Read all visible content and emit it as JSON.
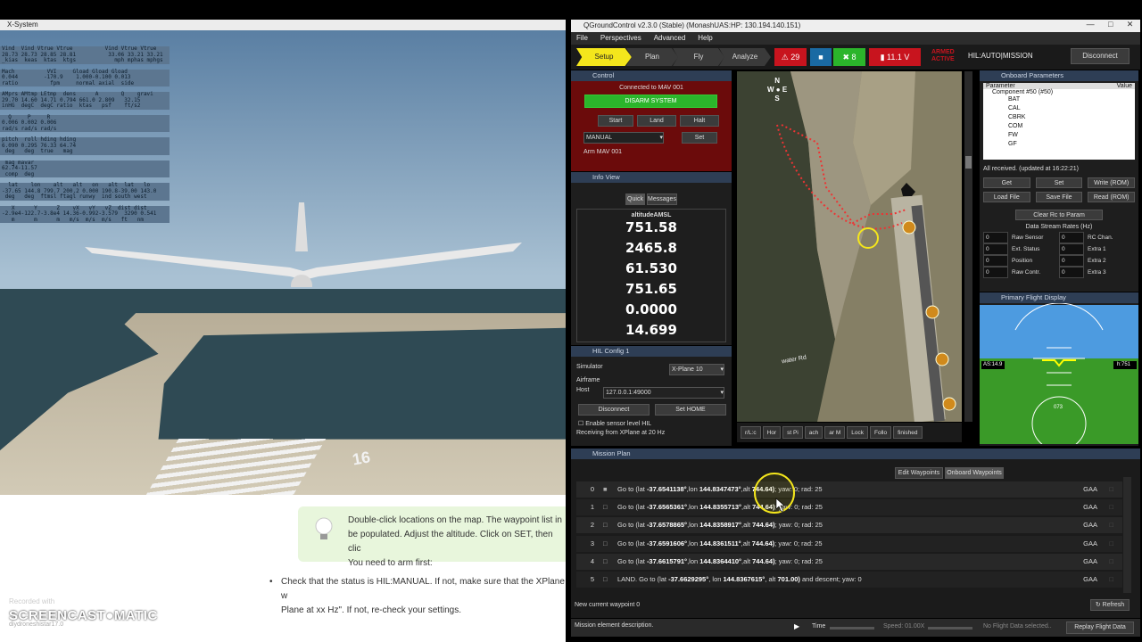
{
  "xplane": {
    "window_title": "X-System",
    "data_lines": [
      "Vind  Vind Vtrue Vtrue          Vind Vtrue Vtrue\n28.73 28.73 28.85 28.81          33.06 33.21 33.21\n_kias  keas  ktas  ktgs            mph mphas mphgs",
      "Mach          VVI     Gload Gload Gload\n0.044        -170.9    1.000-0.100 0.013\nratio          fpm     normal axial  side",
      "AMprs AMtmp LEtmp  dens      A       Q    gravi\n29.70 14.60 14.71 0.794 661.0 2.809   32.15\ninHG  degC  degC ratio  ktas   psf    ft/s2",
      "  Q     P     R\n0.006 0.002 0.006\nrad/s rad/s rad/s",
      "pitch  roll hding hding\n6.090 0.295 76.33 64.74\n deg   deg  true   mag",
      " mag mavar\n62.74-11.57\n comp  deg",
      "  lat    lon    alt   alt   on   alt  lat   lo\n-37.65 144.8 799.7 200.2 0.000 190.8-39.00 143.0\n deg   deg  ftmsl ftagl runwy  ind south west",
      "   X      Y      Z    vX   vY   vZ  dist dist\n-2.9e4-122.7-3.8e4 14.36-0.992-3.579  3290 0.541\n   m      m      m   m/s  m/s  m/s   ft   nm"
    ],
    "runway_number": "16"
  },
  "tutorial": {
    "tip_text": "Double-click locations on the map. The waypoint list in be populated. Adjust the altitude. Click on SET, then click You need to arm first:",
    "tip_line1": "Double-click locations on the map. The waypoint list in",
    "tip_line2": "be populated. Adjust the altitude. Click on SET, then clic",
    "tip_line3": "You need to arm first:",
    "bullet_line1": "Check that the status is HIL:MANUAL. If not, make sure that the XPlane w",
    "bullet_line2": "Plane at xx Hz\". If not, re-check your settings."
  },
  "watermark": {
    "recorded": "Recorded with",
    "brand": "SCREENCAST●MATIC",
    "url": "diydroneshistar17.0"
  },
  "qgc": {
    "title": "QGroundControl v2.3.0 (Stable) (MonashUAS:HP: 130.194.140.151)",
    "menu": [
      "File",
      "Perspectives",
      "Advanced",
      "Help"
    ],
    "tabs": [
      "Setup",
      "Plan",
      "Fly",
      "Analyze"
    ],
    "alerts_count": "29",
    "gps_count": "8",
    "battery": "11.1 V",
    "armed_state": "ARMED",
    "armed_sub": "ACTIVE",
    "mode": "HIL:AUTO|MISSION",
    "disconnect": "Disconnect",
    "control": {
      "title": "Control",
      "connected": "Connected to MAV 001",
      "disarm": "DISARM SYSTEM",
      "start": "Start",
      "land": "Land",
      "halt": "Halt",
      "mode_value": "MANUAL",
      "set": "Set",
      "status": "Arm MAV 001"
    },
    "info": {
      "title": "Info View",
      "tab_quick": "Quick",
      "tab_messages": "Messages",
      "label1": "altitudeAMSL",
      "values": [
        "751.58",
        "2465.8",
        "61.530",
        "751.65",
        "0.0000",
        "14.699"
      ]
    },
    "hil": {
      "title": "HIL Config 1",
      "simulator_label": "Simulator",
      "simulator_value": "X-Plane 10",
      "airframe_label": "Airframe",
      "host_label": "Host",
      "host_value": "127.0.0.1:49000",
      "disconnect": "Disconnect",
      "set_home": "Set HOME",
      "sensor_checkbox": "Enable sensor level HIL",
      "receiving": "Receiving from XPlane at 20 Hz"
    },
    "map_controls": [
      "r/L:c",
      "Hor",
      "st Pi",
      "ach",
      "ar M",
      "Lock",
      "Follo",
      "finished"
    ],
    "compass": {
      "n": "N",
      "s": "S",
      "e": "E",
      "w": "W"
    },
    "road_label": "water Rd",
    "params": {
      "title": "Onboard Parameters",
      "col_param": "Parameter",
      "col_value": "Value",
      "component": "Component #50 (#50)",
      "items": [
        "BAT",
        "CAL",
        "CBRK",
        "COM",
        "FW",
        "GF"
      ],
      "all_received": "All received. (updated at 16:22:21)",
      "buttons": [
        "Get",
        "Set",
        "Write (ROM)",
        "Load File",
        "Save File",
        "Read (ROM)"
      ],
      "clear_rc": "Clear Rc to Param",
      "rates_title": "Data Stream Rates (Hz)",
      "rates_left": [
        "Raw Sensor",
        "Ext. Status",
        "Position",
        "Raw Contr."
      ],
      "rates_right": [
        "RC Chan.",
        "Extra 1",
        "Extra 2",
        "Extra 3"
      ],
      "rate_value": "0"
    },
    "pfd": {
      "title": "Primary Flight Display",
      "left_tape": "AS:14.9",
      "right_tape": "h:751",
      "heading": "073"
    },
    "mission": {
      "title": "Mission Plan",
      "tab_edit": "Edit Waypoints",
      "tab_onboard": "Onboard Waypoints",
      "rows": [
        {
          "idx": "0",
          "pre": "Go to (lat ",
          "lat": "-37.6541138°",
          "mid": ",lon ",
          "lon": "144.8347473°",
          "alt_pre": ",alt ",
          "alt": "744.64)",
          "post": "; yaw: 0; rad: 25",
          "frame": "GAA"
        },
        {
          "idx": "1",
          "pre": "Go to (lat ",
          "lat": "-37.6565361°",
          "mid": ",lon ",
          "lon": "144.8355713°",
          "alt_pre": ",alt ",
          "alt": "744.64)",
          "post": "; yaw: 0; rad: 25",
          "frame": "GAA"
        },
        {
          "idx": "2",
          "pre": "Go to (lat ",
          "lat": "-37.6578865°",
          "mid": ",lon ",
          "lon": "144.8358917°",
          "alt_pre": ",alt ",
          "alt": "744.64)",
          "post": "; yaw: 0; rad: 25",
          "frame": "GAA"
        },
        {
          "idx": "3",
          "pre": "Go to (lat ",
          "lat": "-37.6591606°",
          "mid": ",lon ",
          "lon": "144.8361511°",
          "alt_pre": ",alt ",
          "alt": "744.64)",
          "post": "; yaw: 0; rad: 25",
          "frame": "GAA"
        },
        {
          "idx": "4",
          "pre": "Go to (lat ",
          "lat": "-37.6615791°",
          "mid": ",lon ",
          "lon": "144.8364410°",
          "alt_pre": ",alt ",
          "alt": "744.64)",
          "post": "; yaw: 0; rad: 25",
          "frame": "GAA"
        },
        {
          "idx": "5",
          "pre": "LAND. Go to (lat ",
          "lat": "-37.6629295°",
          "mid": ", lon ",
          "lon": "144.8367615°",
          "alt_pre": ", alt ",
          "alt": "701.00)",
          "post": " and descent; yaw: 0",
          "frame": "GAA"
        }
      ],
      "current_wp": "New current waypoint 0",
      "refresh": "Refresh"
    },
    "statusbar": {
      "description": "Mission element description.",
      "time_label": "Time",
      "speed": "Speed: 01.00X",
      "no_data": "No Flight Data selected..",
      "replay": "Replay Flight Data"
    },
    "colors": {
      "accent_yellow": "#f4e61c",
      "armed_red": "#c8141e",
      "disarm_green": "#2bb52b"
    }
  }
}
